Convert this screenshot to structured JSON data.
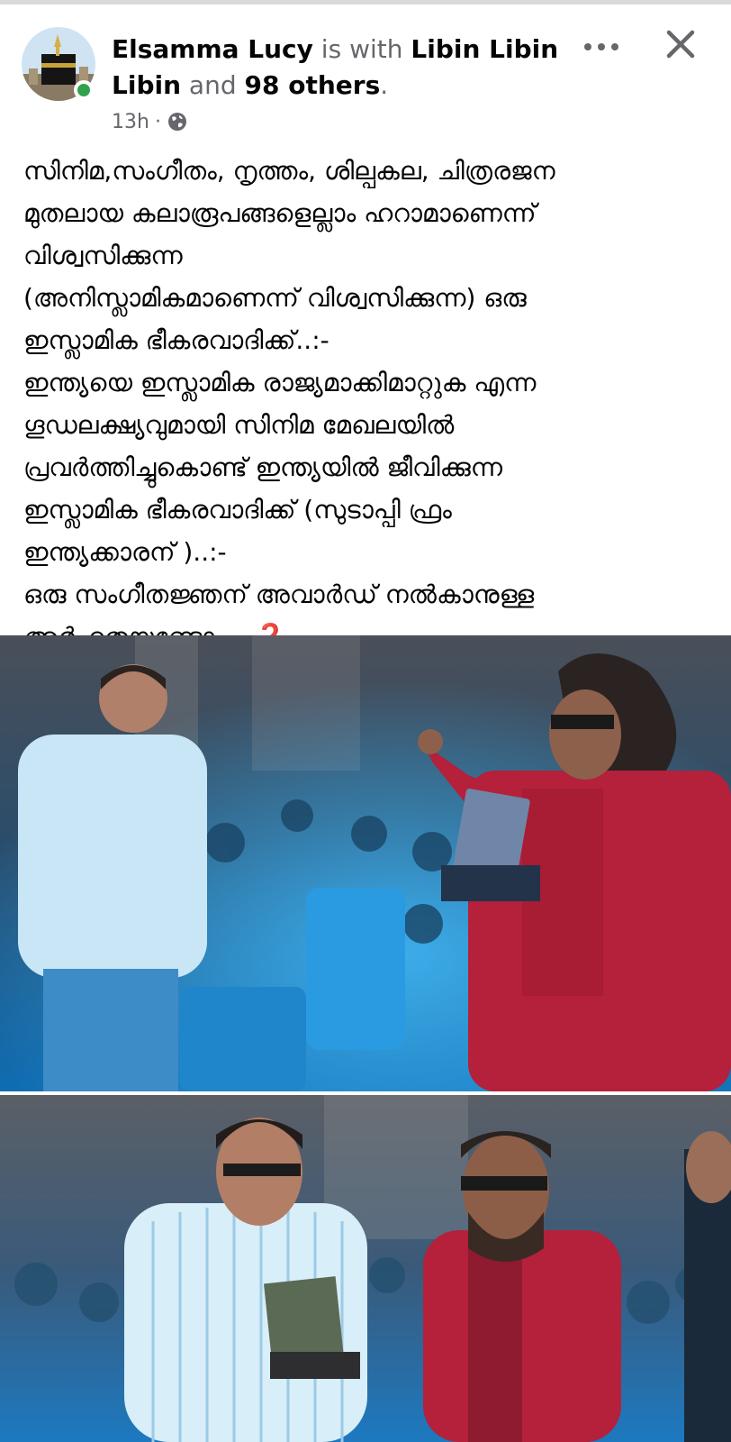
{
  "post": {
    "author": "Elsamma Lucy",
    "with_text": " is with ",
    "tagged": "Libin Libin Libin",
    "and_text": " and ",
    "others": "98 others",
    "period": ".",
    "time": "13h",
    "dot": "·",
    "privacy_icon": "globe-icon",
    "text": "സിനിമ,സംഗീതം, നൃത്തം, ശില്പകല, ചിത്രരജന\nമുതലായ കലാരൂപങ്ങളെല്ലാം ഹറാമാണെന്ന്\nവിശ്വസിക്കുന്ന\n (അനിസ്ലാമികമാണെന്ന് വിശ്വസിക്കുന്ന) ഒരു\nഇസ്ലാമിക ഭീകരവാദിക്ക്..:-\nഇന്ത്യയെ ഇസ്ലാമിക രാജ്യമാക്കിമാറ്റുക എന്ന\nഗൂഡലക്ഷ്യവുമായി സിനിമ മേഖലയിൽ\nപ്രവർത്തിച്ചുകൊണ്ട് ഇന്ത്യയിൽ ജീവിക്കുന്ന\nഇസ്ലാമിക ഭീകരവാദിക്ക് (സുടാപ്പി ഫ്രം\nഇന്ത്യക്കാരന് )..:-\nഒരു സംഗീതജ്ഞന് അവാർഡ് നൽകാനുള്ള\nഅർഹതയുണ്ടോ.... ",
    "emoji": "❓",
    "photo1_overlay": "",
    "photo2_overlay": ""
  },
  "icons": {
    "more": "more-icon",
    "close": "close-icon",
    "globe": "globe-icon"
  },
  "colors": {
    "name": "#050505",
    "secondary": "#65676b",
    "online": "#31a24c",
    "stage_blue": "#1e8fd6",
    "kurta_red": "#b5203a"
  }
}
